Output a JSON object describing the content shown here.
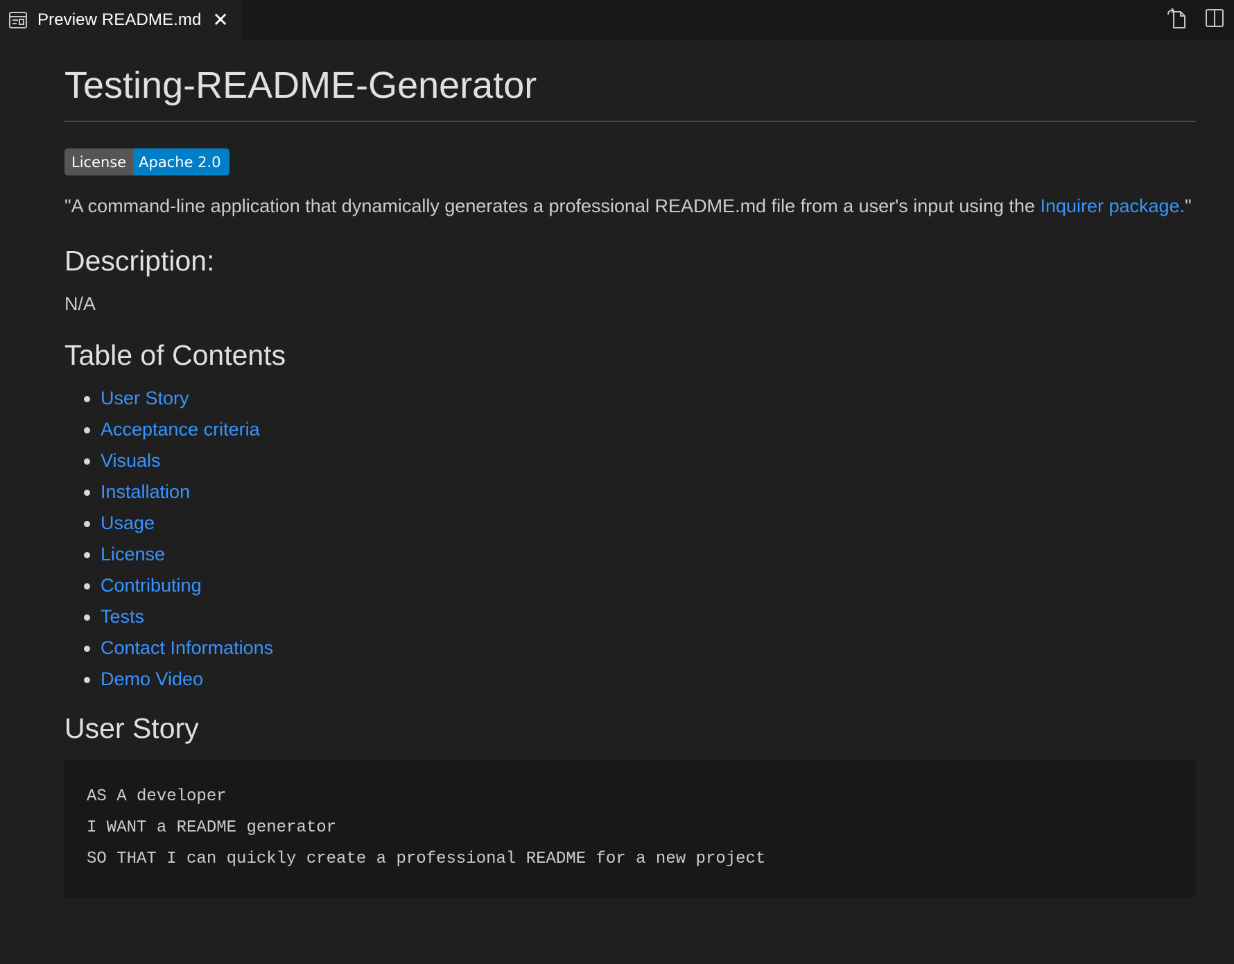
{
  "tab": {
    "icon": "markdown-preview-icon",
    "label": "Preview README.md",
    "close": "✕"
  },
  "actions": [
    {
      "name": "open-source-icon"
    },
    {
      "name": "split-editor-icon"
    }
  ],
  "doc": {
    "title": "Testing-README-Generator",
    "badge": {
      "left": "License",
      "right": "Apache 2.0",
      "left_color": "#555555",
      "right_color": "#007ec6"
    },
    "lead_prefix": "\"A command-line application that dynamically generates a professional README.md file from a user's input using the ",
    "lead_link": "Inquirer package.",
    "lead_suffix": "\"",
    "description_heading": "Description:",
    "description_text": "N/A",
    "toc_heading": "Table of Contents",
    "toc": [
      "User Story",
      "Acceptance criteria",
      "Visuals",
      "Installation",
      "Usage",
      "License",
      "Contributing",
      "Tests",
      "Contact Informations",
      "Demo Video"
    ],
    "user_story_heading": "User Story",
    "user_story_lines": [
      "AS A developer",
      "I WANT a README generator",
      "SO THAT I can quickly create a professional README for a new project"
    ]
  },
  "colors": {
    "link": "#3794ff",
    "background": "#1f1f1f",
    "code_background": "#181818"
  }
}
